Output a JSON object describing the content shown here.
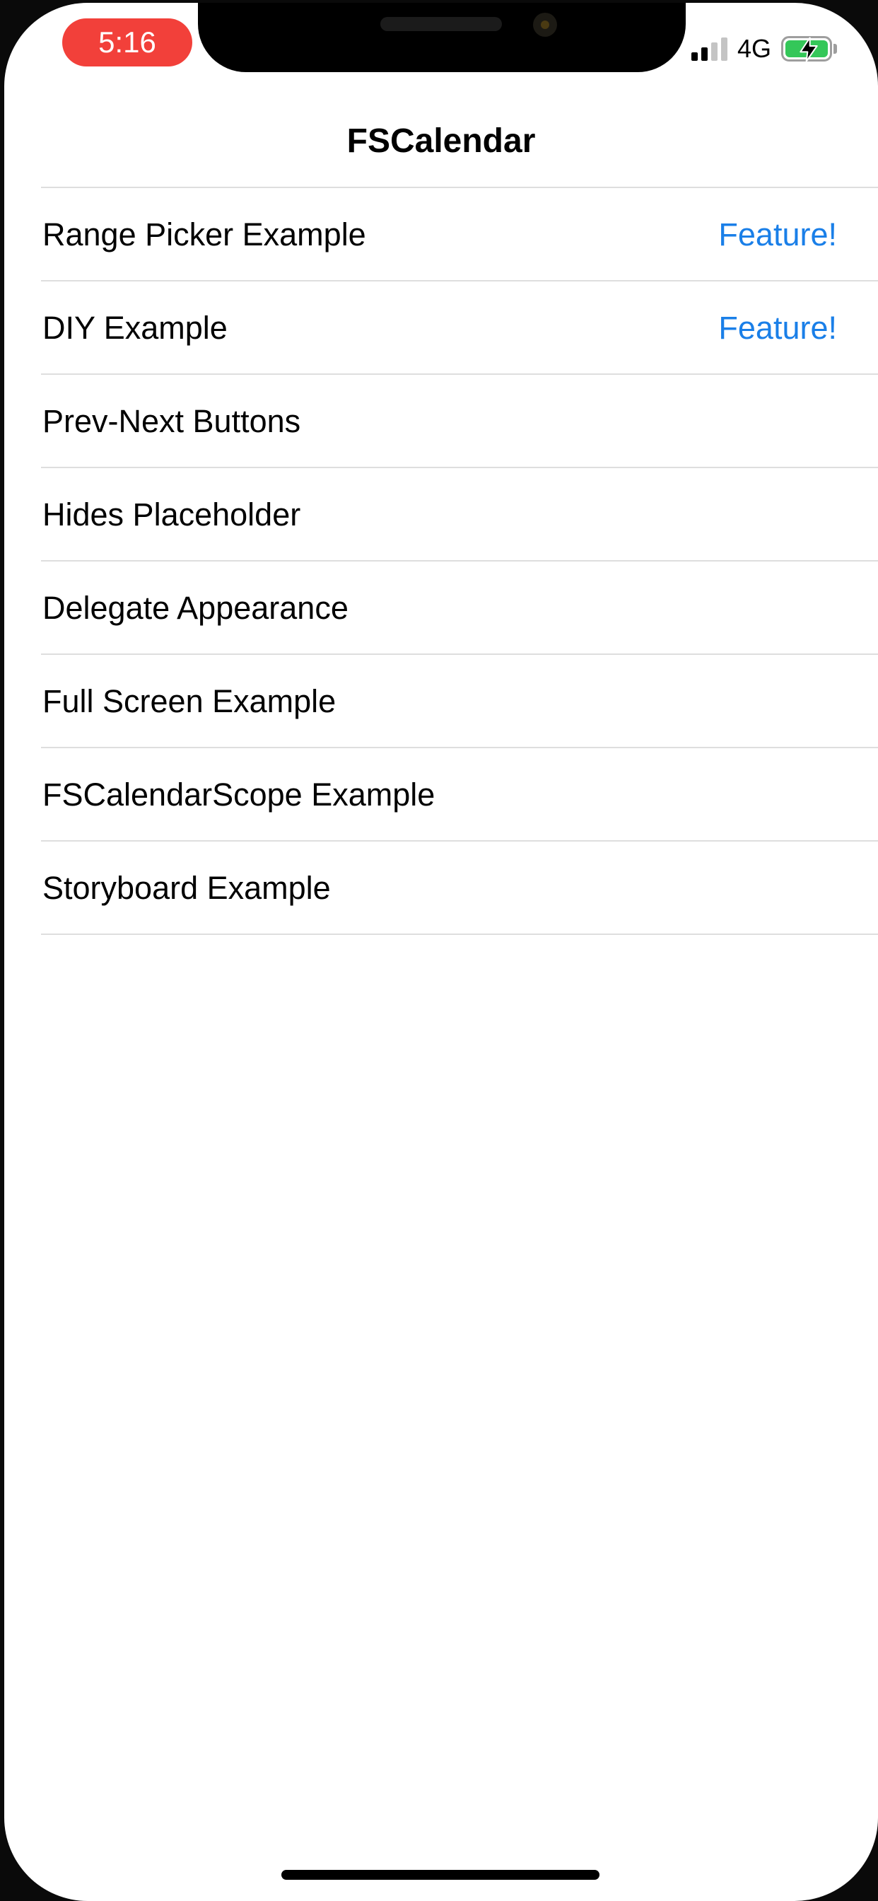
{
  "status_bar": {
    "time": "5:16",
    "network": "4G",
    "signal_bars_active": 2,
    "signal_bars_total": 4,
    "battery_charging": true,
    "time_pill_color": "#f2403a",
    "battery_color": "#34c759"
  },
  "nav": {
    "title": "FSCalendar"
  },
  "rows": [
    {
      "title": "Range Picker Example",
      "detail": "Feature!"
    },
    {
      "title": "DIY Example",
      "detail": "Feature!"
    },
    {
      "title": "Prev-Next Buttons",
      "detail": ""
    },
    {
      "title": "Hides Placeholder",
      "detail": ""
    },
    {
      "title": "Delegate Appearance",
      "detail": ""
    },
    {
      "title": "Full Screen Example",
      "detail": ""
    },
    {
      "title": "FSCalendarScope Example",
      "detail": ""
    },
    {
      "title": "Storyboard Example",
      "detail": ""
    }
  ],
  "colors": {
    "accent": "#1a7fe8",
    "separator": "#dedede"
  }
}
